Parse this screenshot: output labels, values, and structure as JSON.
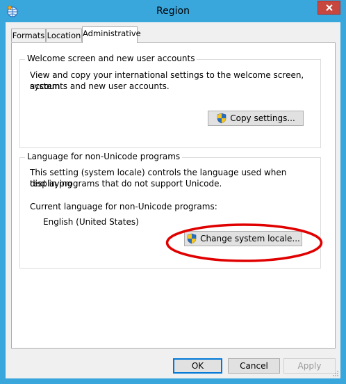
{
  "window": {
    "title": "Region",
    "close_icon": "close-icon",
    "app_icon": "globe-icon",
    "colors": {
      "frame": "#39a6dc",
      "close": "#c7463e",
      "annotation": "#e00000"
    }
  },
  "tabs": [
    {
      "label": "Formats",
      "active": false
    },
    {
      "label": "Location",
      "active": false
    },
    {
      "label": "Administrative",
      "active": true
    }
  ],
  "welcome_group": {
    "title": "Welcome screen and new user accounts",
    "description_line1": "View and copy your international settings to the welcome screen, system",
    "description_line2": "accounts and new user accounts.",
    "copy_button": "Copy settings..."
  },
  "nonunicode_group": {
    "title": "Language for non-Unicode programs",
    "description_line1": "This setting (system locale) controls the language used when displaying",
    "description_line2": "text in programs that do not support Unicode.",
    "current_label": "Current language for non-Unicode programs:",
    "current_value": "English (United States)",
    "change_button": "Change system locale..."
  },
  "footer": {
    "ok": "OK",
    "cancel": "Cancel",
    "apply": "Apply"
  }
}
